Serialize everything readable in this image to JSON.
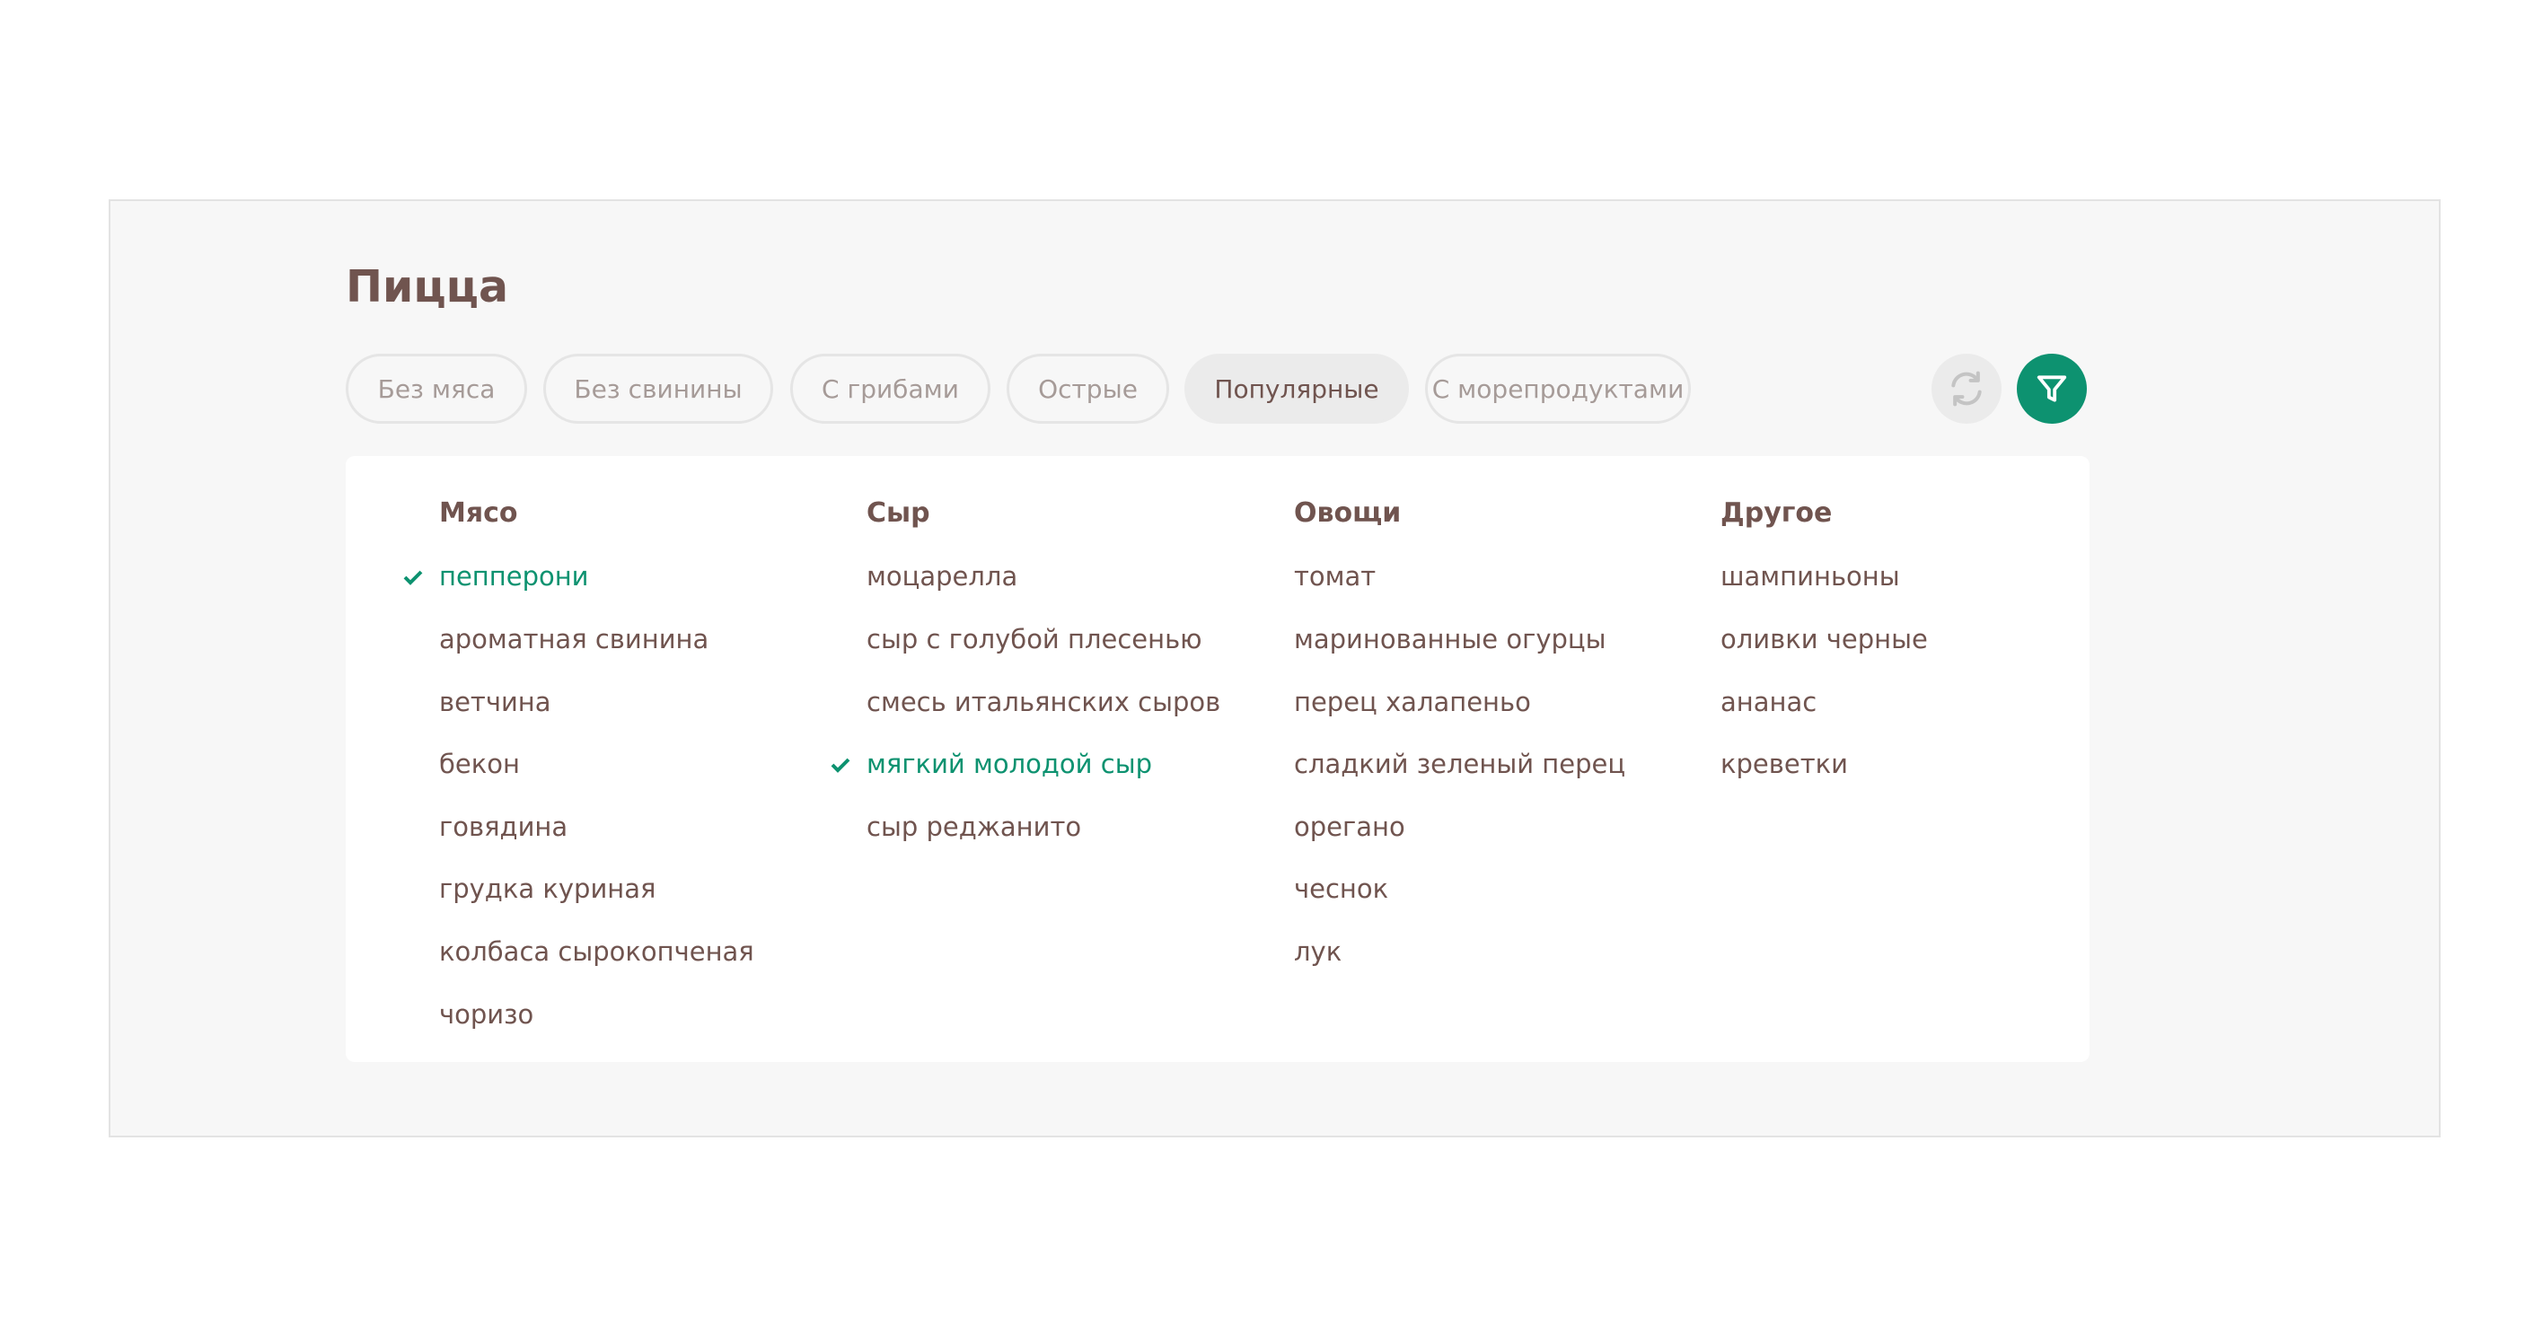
{
  "title": "Пицца",
  "colors": {
    "accent": "#0d9270",
    "text": "#70544f",
    "muted": "#a69b98"
  },
  "tags": [
    {
      "label": "Без мяса",
      "active": false
    },
    {
      "label": "Без свинины",
      "active": false
    },
    {
      "label": "С грибами",
      "active": false
    },
    {
      "label": "Острые",
      "active": false
    },
    {
      "label": "Популярные",
      "active": true
    },
    {
      "label": "С морепродуктами",
      "active": false
    }
  ],
  "buttons": {
    "reset_icon": "refresh-icon",
    "filter_icon": "filter-funnel-icon"
  },
  "columns": [
    {
      "title": "Мясо",
      "items": [
        {
          "label": "пепперони",
          "checked": true
        },
        {
          "label": "ароматная свинина",
          "checked": false
        },
        {
          "label": "ветчина",
          "checked": false
        },
        {
          "label": "бекон",
          "checked": false
        },
        {
          "label": "говядина",
          "checked": false
        },
        {
          "label": "грудка куриная",
          "checked": false
        },
        {
          "label": "колбаса сырокопченая",
          "checked": false
        },
        {
          "label": "чоризо",
          "checked": false
        }
      ]
    },
    {
      "title": "Сыр",
      "items": [
        {
          "label": "моцарелла",
          "checked": false
        },
        {
          "label": "сыр с голубой плесенью",
          "checked": false
        },
        {
          "label": "смесь итальянских сыров",
          "checked": false
        },
        {
          "label": "мягкий молодой сыр",
          "checked": true
        },
        {
          "label": "сыр реджанито",
          "checked": false
        }
      ]
    },
    {
      "title": "Овощи",
      "items": [
        {
          "label": "томат",
          "checked": false
        },
        {
          "label": "маринованные огурцы",
          "checked": false
        },
        {
          "label": "перец халапеньо",
          "checked": false
        },
        {
          "label": "сладкий зеленый перец",
          "checked": false
        },
        {
          "label": "орегано",
          "checked": false
        },
        {
          "label": "чеснок",
          "checked": false
        },
        {
          "label": "лук",
          "checked": false
        }
      ]
    },
    {
      "title": "Другое",
      "items": [
        {
          "label": "шампиньоны",
          "checked": false
        },
        {
          "label": "оливки черные",
          "checked": false
        },
        {
          "label": "ананас",
          "checked": false
        },
        {
          "label": "креветки",
          "checked": false
        }
      ]
    }
  ]
}
